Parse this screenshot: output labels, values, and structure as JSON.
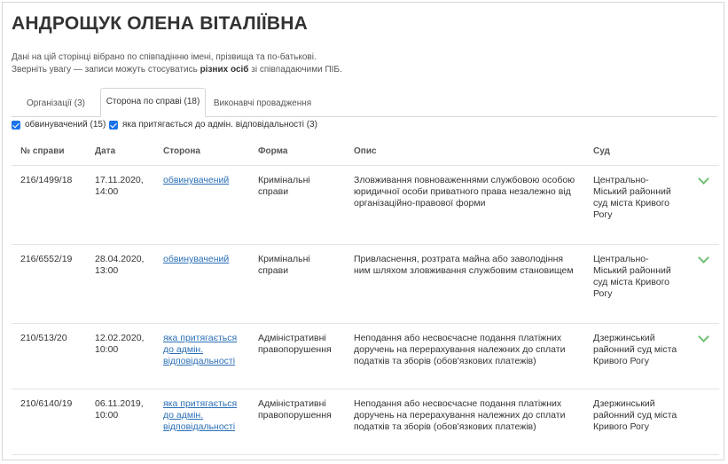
{
  "page": {
    "title": "АНДРОЩУК ОЛЕНА ВІТАЛІЇВНА",
    "note_line1": "Дані на цій сторінці вібрано по співпадінню імені, прізвища та по-батькові.",
    "note_line2_prefix": "Зверніть увагу — записи можуть стосуватись ",
    "note_line2_bold": "різних осіб",
    "note_line2_suffix": " зі співпадаючими ПІБ."
  },
  "tabs": [
    {
      "label": "Організації (3)",
      "active": false
    },
    {
      "label": "Сторона по справі (18)",
      "active": true
    },
    {
      "label": "Виконавчі провадження",
      "active": false
    }
  ],
  "filters": [
    {
      "label": "обвинувачений (15)",
      "checked": true
    },
    {
      "label": "яка притягається до адмін. відповідальності (3)",
      "checked": true
    }
  ],
  "table": {
    "columns": [
      "№ справи",
      "Дата",
      "Сторона",
      "Форма",
      "Опис",
      "Суд"
    ],
    "rows": [
      {
        "case_no": "216/1499/18",
        "date": "17.11.2020,",
        "time": "14:00",
        "party": "обвинувачений",
        "form": "Кримінальні справи",
        "description": "Зловживання повноваженнями службовою особою юридичної особи приватного права незалежно від організаційно-правової форми",
        "court": "Центрально-Міський районний суд міста Кривого Рогу",
        "expandable": true
      },
      {
        "case_no": "216/6552/19",
        "date": "28.04.2020,",
        "time": "13:00",
        "party": "обвинувачений",
        "form": "Кримінальні справи",
        "description": "Привласнення, розтрата майна або заволодіння ним шляхом зловживання службовим становищем",
        "court": "Центрально-Міський районний суд міста Кривого Рогу",
        "expandable": true
      },
      {
        "case_no": "210/513/20",
        "date": "12.02.2020,",
        "time": "10:00",
        "party": "яка притягається до адмін. відповідальності",
        "form": "Адміністративні правопорушення",
        "description": "Неподання або несвоєчасне подання платіжних доручень на перерахування належних до сплати податків та зборів (обов'язкових платежів)",
        "court": "Дзержинський районний суд міста Кривого Рогу",
        "expandable": true
      },
      {
        "case_no": "210/6140/19",
        "date": "06.11.2019,",
        "time": "10:00",
        "party": "яка притягається до адмін. відповідальності",
        "form": "Адміністративні правопорушення",
        "description": "Неподання або несвоєчасне подання платіжних доручень на перерахування належних до сплати податків та зборів (обов'язкових платежів)",
        "court": "Дзержинський районний суд міста Кривого Рогу",
        "expandable": false
      }
    ]
  },
  "colors": {
    "link": "#2a6fb6",
    "chevron": "#6fbf73",
    "checkbox": "#1a73e8",
    "border": "#d6d6d6"
  }
}
